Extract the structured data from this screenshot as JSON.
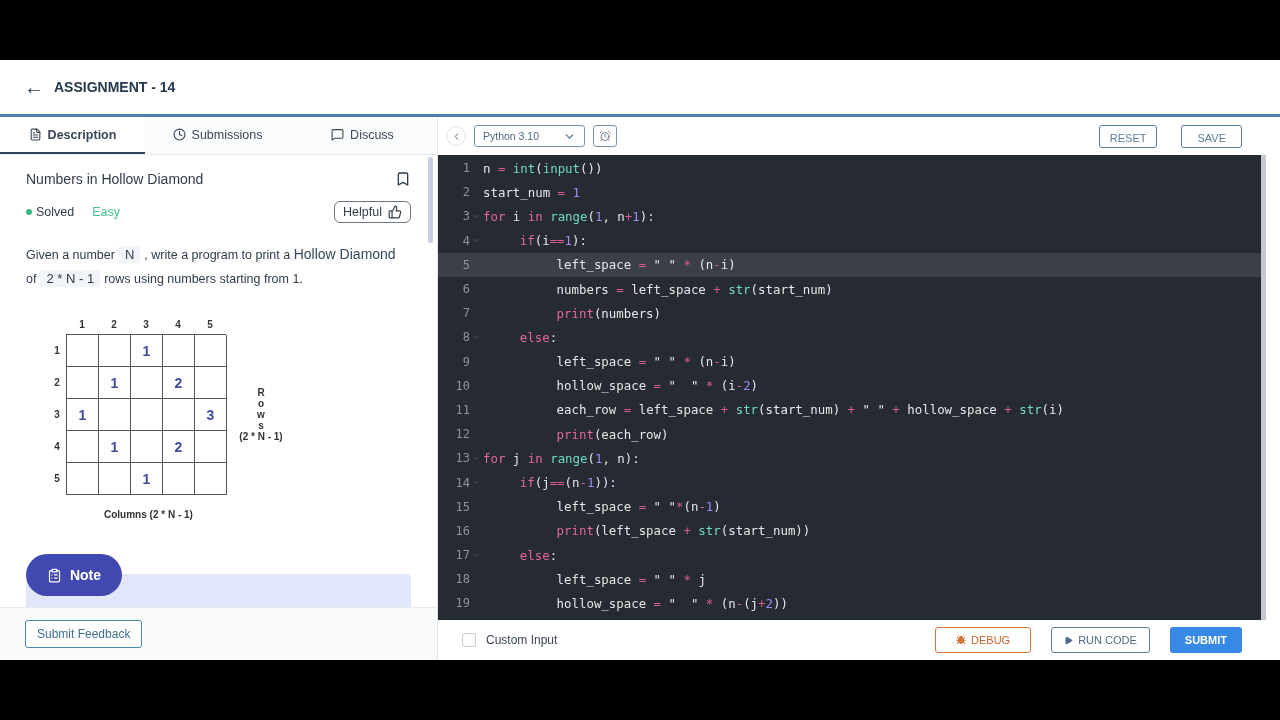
{
  "header": {
    "back": "←",
    "title": "ASSIGNMENT - 14"
  },
  "tabs": [
    {
      "label": "Description",
      "selected": true
    },
    {
      "label": "Submissions",
      "selected": false
    },
    {
      "label": "Discuss",
      "selected": false
    }
  ],
  "problem": {
    "title": "Numbers in Hollow Diamond",
    "bookmarked": false,
    "status": "Solved",
    "difficulty": "Easy",
    "helpful": "Helpful",
    "description": [
      {
        "text": "Given a number",
        "kind": "text"
      },
      {
        "text": "N",
        "kind": "code"
      },
      {
        "text": ", write a program to print a",
        "kind": "text"
      },
      {
        "text": "Hollow Diamond",
        "kind": "strong"
      },
      {
        "text": "of",
        "kind": "text"
      },
      {
        "text": "2 * N - 1",
        "kind": "code"
      },
      {
        "text": "rows using numbers starting from 1.",
        "kind": "text"
      }
    ]
  },
  "grid": {
    "column_headers": [
      "1",
      "2",
      "3",
      "4",
      "5"
    ],
    "rows": [
      {
        "header": "1",
        "cells": [
          null,
          null,
          "1",
          null,
          null
        ]
      },
      {
        "header": "2",
        "cells": [
          null,
          "1",
          null,
          "2",
          null
        ]
      },
      {
        "header": "3",
        "cells": [
          "1",
          null,
          null,
          null,
          "3"
        ]
      },
      {
        "header": "4",
        "cells": [
          null,
          "1",
          null,
          "2",
          null
        ]
      },
      {
        "header": "5",
        "cells": [
          null,
          null,
          "1",
          null,
          null
        ]
      }
    ],
    "rows_label": "Rows",
    "rows_formula": "(2 * N - 1)",
    "columns_label": "Columns (2 * N - 1)"
  },
  "note": {
    "label": "Note"
  },
  "feedback_button": "Submit Feedback",
  "editor": {
    "language": "Python 3.10",
    "reset": "RESET",
    "save": "SAVE",
    "lines": [
      {
        "number": "1",
        "selected": false,
        "tokens": [
          {
            "text": "n",
            "kind": "plain"
          },
          {
            "text": " = ",
            "kind": "op"
          },
          {
            "text": "int",
            "kind": "builtin"
          },
          {
            "text": "(",
            "kind": "plain"
          },
          {
            "text": "input",
            "kind": "builtin"
          },
          {
            "text": "())",
            "kind": "plain"
          }
        ]
      },
      {
        "number": "2",
        "selected": false,
        "tokens": [
          {
            "text": "start_num",
            "kind": "plain"
          },
          {
            "text": " = ",
            "kind": "op"
          },
          {
            "text": "1",
            "kind": "number"
          }
        ]
      },
      {
        "number": "3",
        "selected": false,
        "tokens": [
          {
            "text": "for",
            "kind": "keyword"
          },
          {
            "text": " i ",
            "kind": "plain"
          },
          {
            "text": "in ",
            "kind": "keyword"
          },
          {
            "text": "range",
            "kind": "builtin"
          },
          {
            "text": "(",
            "kind": "plain"
          },
          {
            "text": "1",
            "kind": "number"
          },
          {
            "text": ", n",
            "kind": "plain"
          },
          {
            "text": "+",
            "kind": "op"
          },
          {
            "text": "1",
            "kind": "number"
          },
          {
            "text": "):",
            "kind": "plain"
          }
        ],
        "children": [
          {
            "number": "4",
            "selected": false,
            "tokens": [
              {
                "text": "if",
                "kind": "keyword"
              },
              {
                "text": "(i",
                "kind": "plain"
              },
              {
                "text": "==",
                "kind": "op"
              },
              {
                "text": "1",
                "kind": "number"
              },
              {
                "text": "):",
                "kind": "plain"
              }
            ],
            "children": [
              {
                "number": "5",
                "selected": true,
                "tokens": [
                  {
                    "text": "left_space",
                    "kind": "plain"
                  },
                  {
                    "text": " = ",
                    "kind": "op"
                  },
                  {
                    "text": "\" \"",
                    "kind": "plain"
                  },
                  {
                    "text": " * ",
                    "kind": "op"
                  },
                  {
                    "text": "(n",
                    "kind": "plain"
                  },
                  {
                    "text": "-",
                    "kind": "op"
                  },
                  {
                    "text": "i)",
                    "kind": "plain"
                  }
                ]
              },
              {
                "number": "6",
                "selected": false,
                "tokens": [
                  {
                    "text": "numbers",
                    "kind": "plain"
                  },
                  {
                    "text": " = ",
                    "kind": "op"
                  },
                  {
                    "text": "left_space",
                    "kind": "plain"
                  },
                  {
                    "text": " + ",
                    "kind": "op"
                  },
                  {
                    "text": "str",
                    "kind": "builtin"
                  },
                  {
                    "text": "(start_num)",
                    "kind": "plain"
                  }
                ]
              },
              {
                "number": "7",
                "selected": false,
                "tokens": [
                  {
                    "text": "print",
                    "kind": "keyword"
                  },
                  {
                    "text": "(numbers)",
                    "kind": "plain"
                  }
                ]
              }
            ]
          },
          {
            "number": "8",
            "selected": false,
            "tokens": [
              {
                "text": "else",
                "kind": "keyword"
              },
              {
                "text": ":",
                "kind": "plain"
              }
            ],
            "children": [
              {
                "number": "9",
                "selected": false,
                "tokens": [
                  {
                    "text": "left_space",
                    "kind": "plain"
                  },
                  {
                    "text": " = ",
                    "kind": "op"
                  },
                  {
                    "text": "\" \"",
                    "kind": "plain"
                  },
                  {
                    "text": " * ",
                    "kind": "op"
                  },
                  {
                    "text": "(n",
                    "kind": "plain"
                  },
                  {
                    "text": "-",
                    "kind": "op"
                  },
                  {
                    "text": "i)",
                    "kind": "plain"
                  }
                ]
              },
              {
                "number": "10",
                "selected": false,
                "tokens": [
                  {
                    "text": "hollow_space",
                    "kind": "plain"
                  },
                  {
                    "text": " = ",
                    "kind": "op"
                  },
                  {
                    "text": "\"  \"",
                    "kind": "plain"
                  },
                  {
                    "text": " * ",
                    "kind": "op"
                  },
                  {
                    "text": "(i",
                    "kind": "plain"
                  },
                  {
                    "text": "-",
                    "kind": "op"
                  },
                  {
                    "text": "2",
                    "kind": "number"
                  },
                  {
                    "text": ")",
                    "kind": "plain"
                  }
                ]
              },
              {
                "number": "11",
                "selected": false,
                "tokens": [
                  {
                    "text": "each_row",
                    "kind": "plain"
                  },
                  {
                    "text": " = ",
                    "kind": "op"
                  },
                  {
                    "text": "left_space",
                    "kind": "plain"
                  },
                  {
                    "text": " + ",
                    "kind": "op"
                  },
                  {
                    "text": "str",
                    "kind": "builtin"
                  },
                  {
                    "text": "(start_num)",
                    "kind": "plain"
                  },
                  {
                    "text": " + ",
                    "kind": "op"
                  },
                  {
                    "text": "\" \"",
                    "kind": "plain"
                  },
                  {
                    "text": " + ",
                    "kind": "op"
                  },
                  {
                    "text": "hollow_space",
                    "kind": "plain"
                  },
                  {
                    "text": " + ",
                    "kind": "op"
                  },
                  {
                    "text": "str",
                    "kind": "builtin"
                  },
                  {
                    "text": "(i)",
                    "kind": "plain"
                  }
                ]
              },
              {
                "number": "12",
                "selected": false,
                "tokens": [
                  {
                    "text": "print",
                    "kind": "keyword"
                  },
                  {
                    "text": "(each_row)",
                    "kind": "plain"
                  }
                ]
              }
            ]
          }
        ]
      },
      {
        "number": "13",
        "selected": false,
        "tokens": [
          {
            "text": "for",
            "kind": "keyword"
          },
          {
            "text": " j ",
            "kind": "plain"
          },
          {
            "text": "in ",
            "kind": "keyword"
          },
          {
            "text": "range",
            "kind": "builtin"
          },
          {
            "text": "(",
            "kind": "plain"
          },
          {
            "text": "1",
            "kind": "number"
          },
          {
            "text": ", n):",
            "kind": "plain"
          }
        ],
        "children": [
          {
            "number": "14",
            "selected": false,
            "tokens": [
              {
                "text": "if",
                "kind": "keyword"
              },
              {
                "text": "(j",
                "kind": "plain"
              },
              {
                "text": "==",
                "kind": "op"
              },
              {
                "text": "(n",
                "kind": "plain"
              },
              {
                "text": "-",
                "kind": "op"
              },
              {
                "text": "1",
                "kind": "number"
              },
              {
                "text": ")):",
                "kind": "plain"
              }
            ],
            "children": [
              {
                "number": "15",
                "selected": false,
                "tokens": [
                  {
                    "text": "left_space",
                    "kind": "plain"
                  },
                  {
                    "text": " = ",
                    "kind": "op"
                  },
                  {
                    "text": "\" \"",
                    "kind": "plain"
                  },
                  {
                    "text": "*",
                    "kind": "op"
                  },
                  {
                    "text": "(n",
                    "kind": "plain"
                  },
                  {
                    "text": "-",
                    "kind": "op"
                  },
                  {
                    "text": "1",
                    "kind": "number"
                  },
                  {
                    "text": ")",
                    "kind": "plain"
                  }
                ]
              },
              {
                "number": "16",
                "selected": false,
                "tokens": [
                  {
                    "text": "print",
                    "kind": "keyword"
                  },
                  {
                    "text": "(left_space",
                    "kind": "plain"
                  },
                  {
                    "text": " + ",
                    "kind": "op"
                  },
                  {
                    "text": "str",
                    "kind": "builtin"
                  },
                  {
                    "text": "(start_num))",
                    "kind": "plain"
                  }
                ]
              }
            ]
          },
          {
            "number": "17",
            "selected": false,
            "tokens": [
              {
                "text": "else",
                "kind": "keyword"
              },
              {
                "text": ":",
                "kind": "plain"
              }
            ],
            "children": [
              {
                "number": "18",
                "selected": false,
                "tokens": [
                  {
                    "text": "left_space",
                    "kind": "plain"
                  },
                  {
                    "text": " = ",
                    "kind": "op"
                  },
                  {
                    "text": "\" \"",
                    "kind": "plain"
                  },
                  {
                    "text": " * ",
                    "kind": "op"
                  },
                  {
                    "text": "j",
                    "kind": "plain"
                  }
                ]
              },
              {
                "number": "19",
                "selected": false,
                "tokens": [
                  {
                    "text": "hollow_space",
                    "kind": "plain"
                  },
                  {
                    "text": " = ",
                    "kind": "op"
                  },
                  {
                    "text": "\"  \"",
                    "kind": "plain"
                  },
                  {
                    "text": " * ",
                    "kind": "op"
                  },
                  {
                    "text": "(n",
                    "kind": "plain"
                  },
                  {
                    "text": "-",
                    "kind": "op"
                  },
                  {
                    "text": "(j",
                    "kind": "plain"
                  },
                  {
                    "text": "+",
                    "kind": "op"
                  },
                  {
                    "text": "2",
                    "kind": "number"
                  },
                  {
                    "text": "))",
                    "kind": "plain"
                  }
                ]
              }
            ]
          }
        ]
      }
    ]
  },
  "footer": {
    "custom_input": {
      "label": "Custom Input",
      "checked": false
    },
    "debug": "DEBUG",
    "run": "RUN CODE",
    "submit": "SUBMIT"
  }
}
